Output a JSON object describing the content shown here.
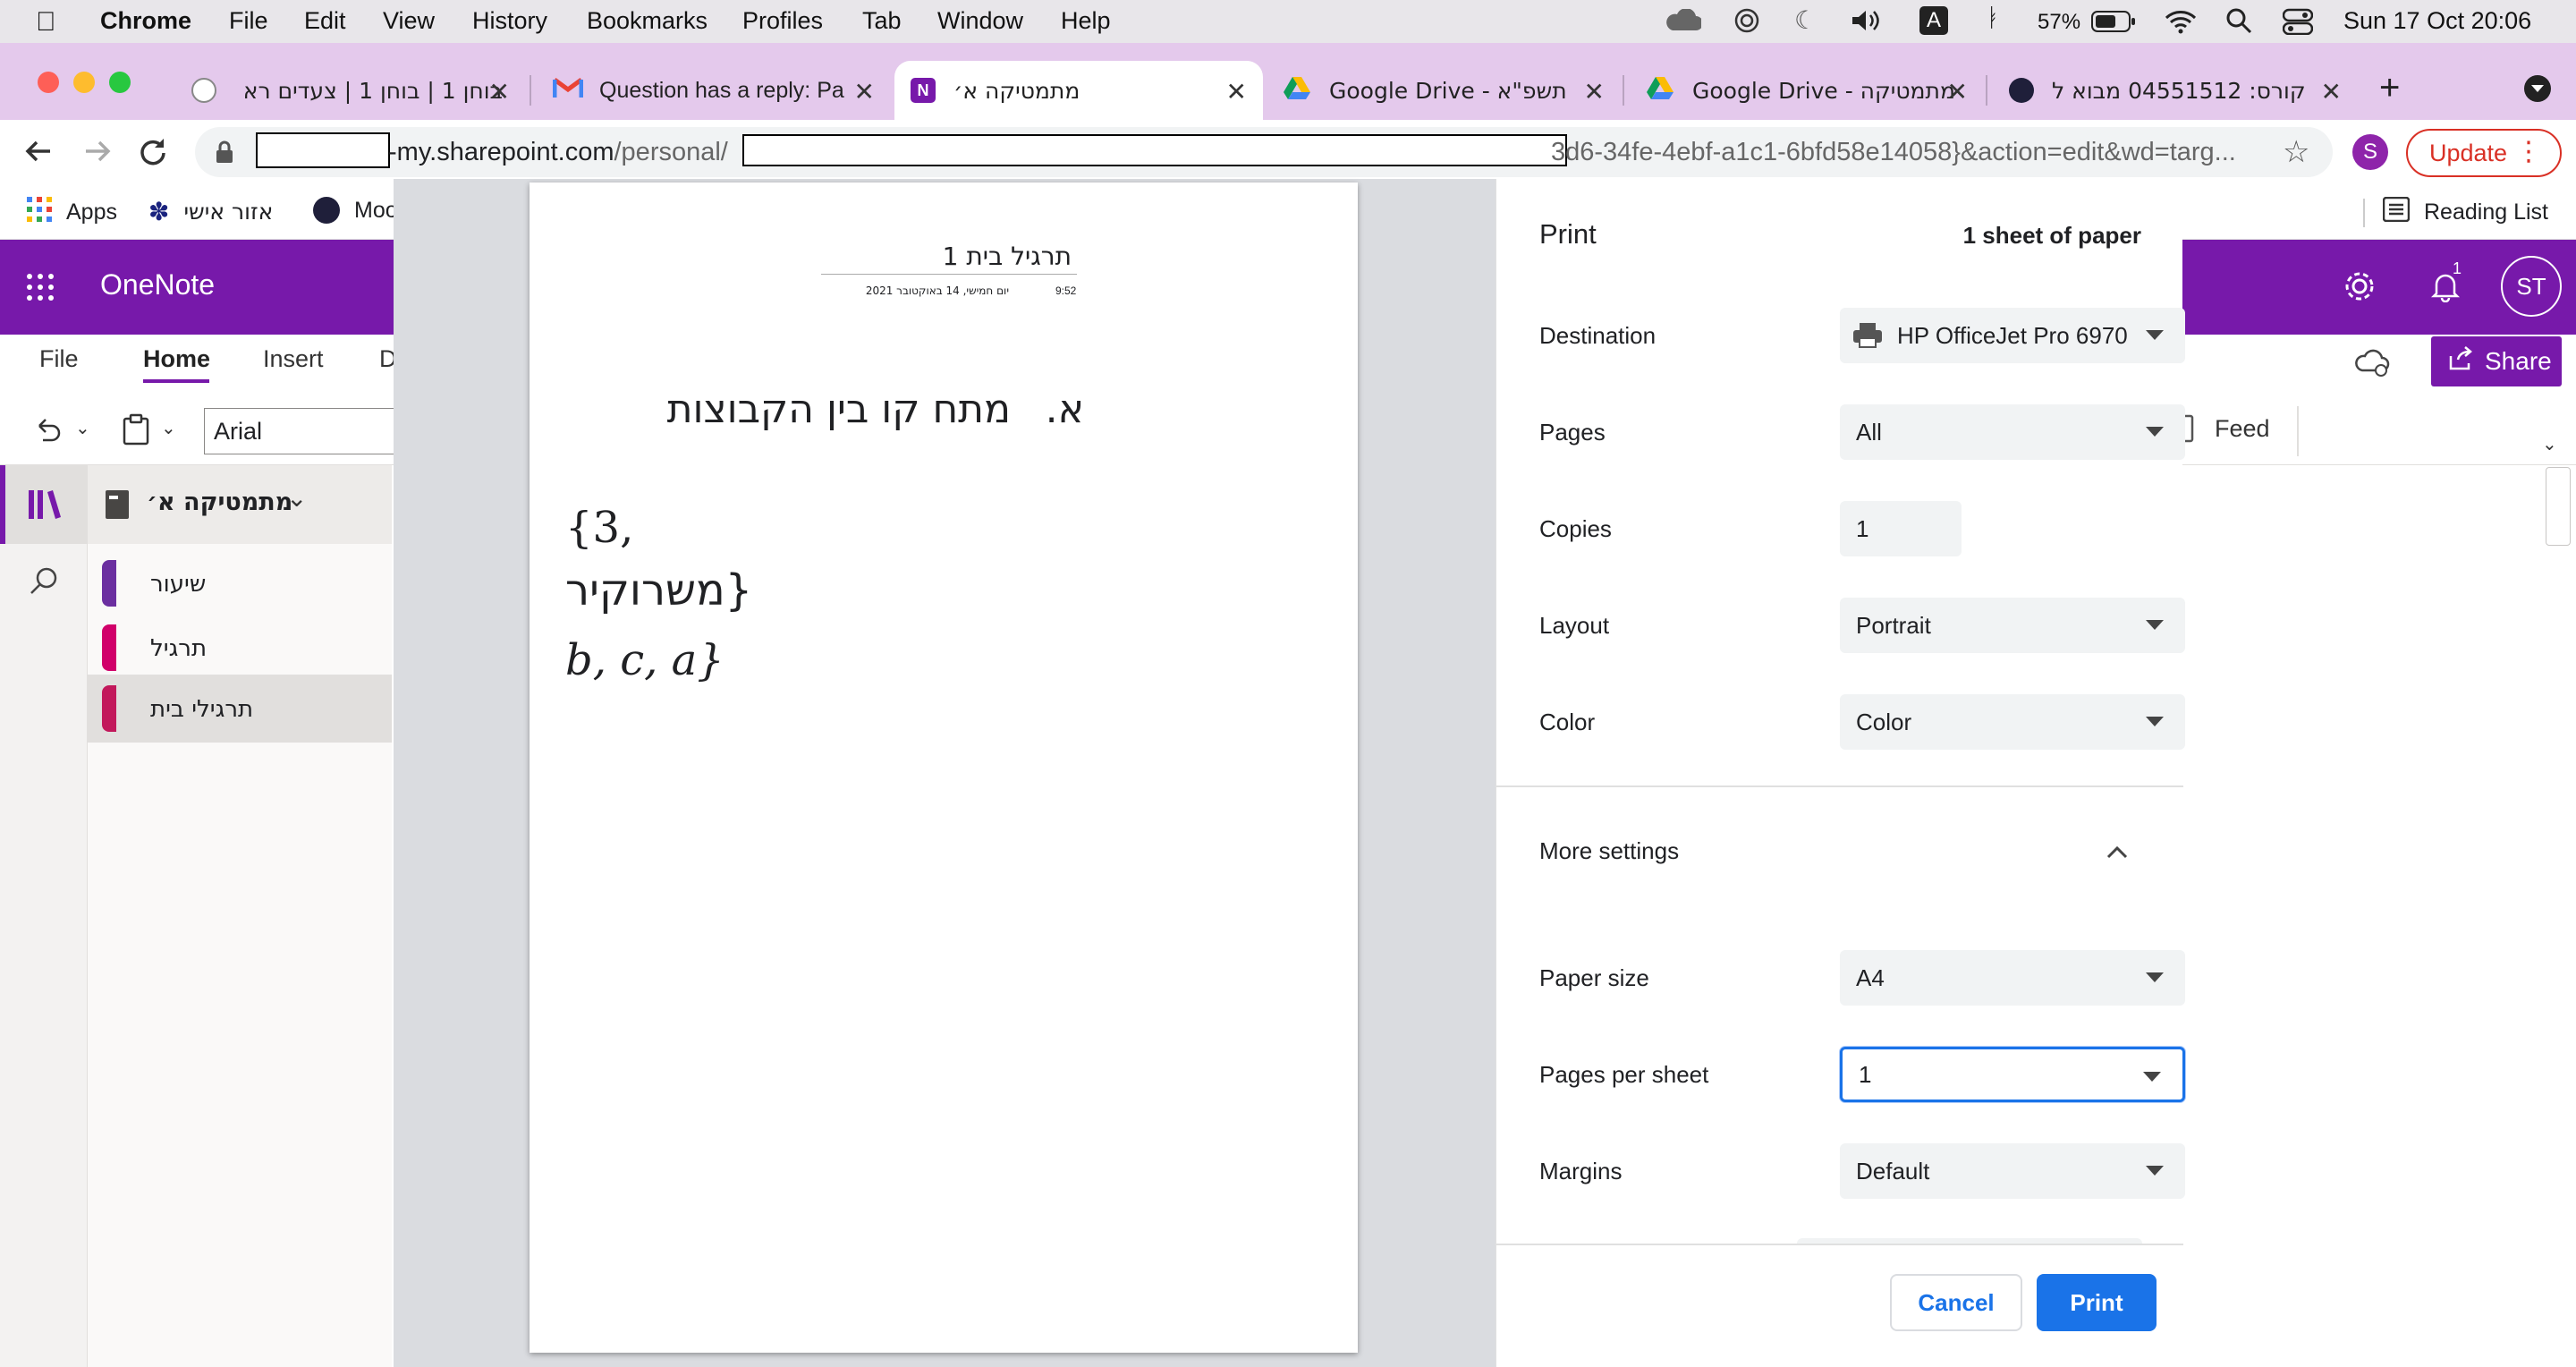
{
  "menubar": {
    "app": "Chrome",
    "items": [
      "File",
      "Edit",
      "View",
      "History",
      "Bookmarks",
      "Profiles",
      "Tab",
      "Window",
      "Help"
    ],
    "input_badge": "A",
    "battery": "57%",
    "datetime": "Sun 17 Oct  20:06"
  },
  "tabs": [
    {
      "title": "בוחן 1 | בוחן 1 | צעדים רא",
      "icon": "moodle-icon"
    },
    {
      "title": "Question has a reply: Pa",
      "icon": "gmail-icon"
    },
    {
      "title": "מתמטיקה א׳",
      "icon": "onenote-icon",
      "active": true
    },
    {
      "title": "תשפ\"א - Google Drive",
      "icon": "google-drive-icon"
    },
    {
      "title": "מתמטיקה - Google Drive",
      "icon": "google-drive-icon"
    },
    {
      "title": "קורס: 04551512 מבוא ל",
      "icon": "moodle-icon"
    }
  ],
  "address": {
    "host": "-my.sharepoint.com",
    "path_start": "/personal/",
    "path_end": "3d6-34fe-4ebf-a1c1-6bfd58e14058}&action=edit&wd=targ..."
  },
  "toolbar": {
    "profile_initial": "S",
    "update_label": "Update"
  },
  "bookmarks": {
    "items": [
      {
        "label": "Apps",
        "icon": "apps-grid-icon"
      },
      {
        "label": "אזור אישי",
        "icon": "university-logo-icon"
      },
      {
        "label": "Moo",
        "icon": "moodle-icon"
      }
    ],
    "reading_list": "Reading List"
  },
  "onenote": {
    "app_name": "OneNote",
    "notification_count": "1",
    "avatar_initials": "ST",
    "share_label": "Share",
    "ribbon_tabs": [
      "File",
      "Home",
      "Insert",
      "D"
    ],
    "active_tab": "Home",
    "font_name": "Arial",
    "feed_label": "Feed",
    "notebook": "מתמטיקה א׳",
    "sections": [
      {
        "name": "שיעור",
        "color": "#6b2fa0"
      },
      {
        "name": "תרגיל",
        "color": "#d1006a"
      },
      {
        "name": "תרגילי בית",
        "color": "#c2185b",
        "selected": true
      }
    ]
  },
  "preview": {
    "page_title": "תרגיל בית 1",
    "date_line": "יום חמישי, 14 באוקטובר 2021",
    "time": "9:52",
    "heading_letter": "א.",
    "heading_text": "מתח קו בין הקבוצות",
    "line1": "{3,",
    "line2": "{משרוקיר",
    "line3": "{b, c, a"
  },
  "print": {
    "title": "Print",
    "sheets": "1 sheet of paper",
    "fields": [
      {
        "label": "Destination",
        "value": "HP OfficeJet Pro 6970",
        "type": "select"
      },
      {
        "label": "Pages",
        "value": "All",
        "type": "select"
      },
      {
        "label": "Copies",
        "value": "1",
        "type": "input"
      },
      {
        "label": "Layout",
        "value": "Portrait",
        "type": "select"
      },
      {
        "label": "Color",
        "value": "Color",
        "type": "select"
      }
    ],
    "more_settings": "More settings",
    "more_fields": [
      {
        "label": "Paper size",
        "value": "A4"
      },
      {
        "label": "Pages per sheet",
        "value": "1"
      },
      {
        "label": "Margins",
        "value": "Default"
      }
    ],
    "cancel_label": "Cancel",
    "print_label": "Print",
    "accent": "#1a73e8"
  }
}
